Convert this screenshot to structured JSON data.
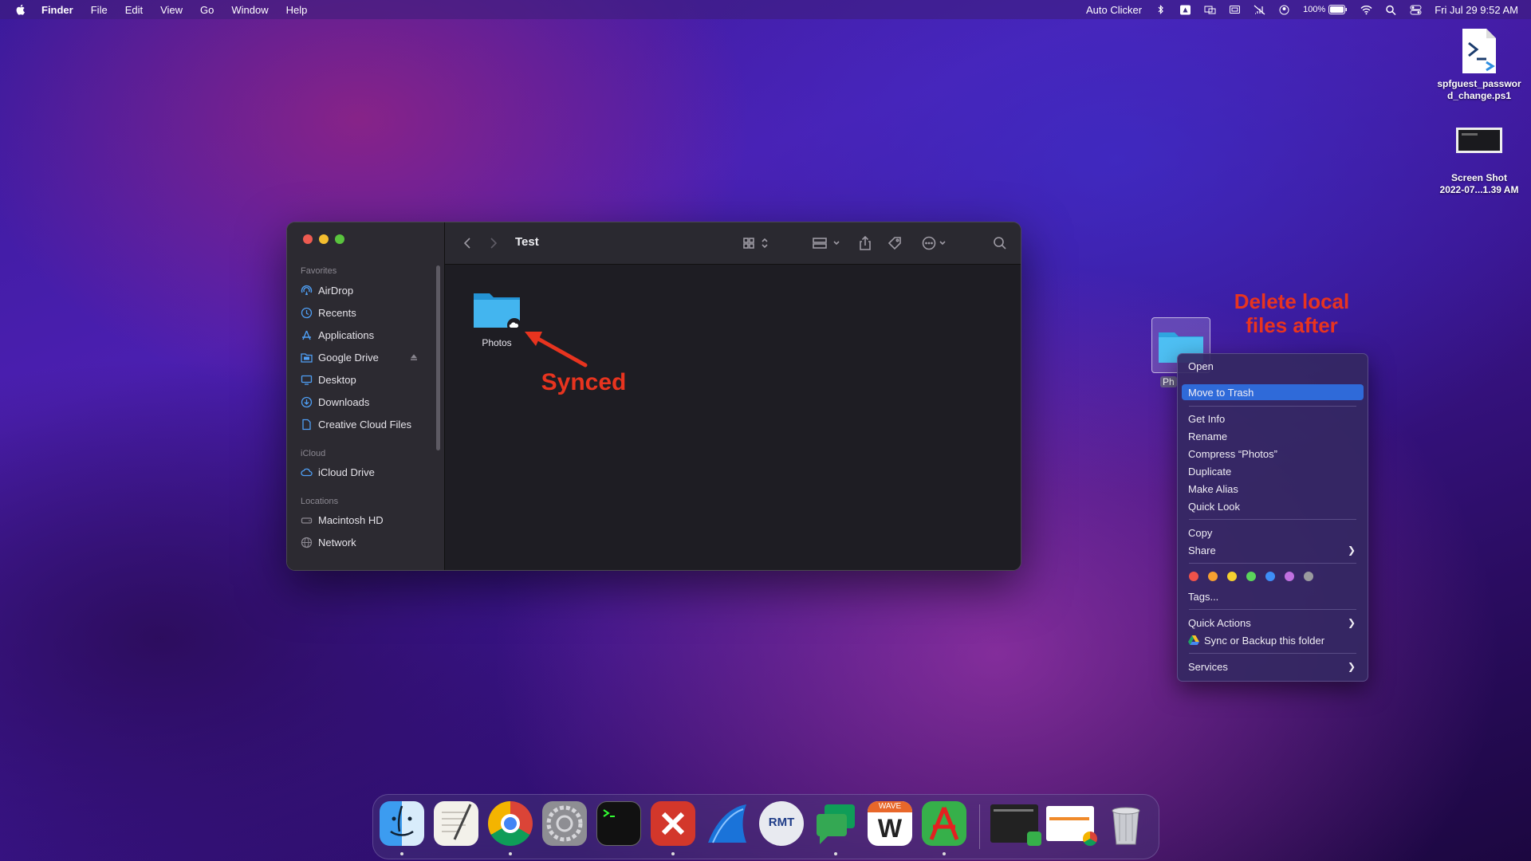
{
  "menubar": {
    "app_name": "Finder",
    "menus": [
      "File",
      "Edit",
      "View",
      "Go",
      "Window",
      "Help"
    ],
    "right": {
      "auto_clicker": "Auto Clicker",
      "battery": "100%",
      "datetime": "Fri Jul 29  9:52 AM"
    }
  },
  "desktop": {
    "items": [
      {
        "label_line1": "spfguest_passwor",
        "label_line2": "d_change.ps1",
        "icon": "powershell-script-icon"
      },
      {
        "label_line1": "Screen Shot",
        "label_line2": "2022-07...1.39 AM",
        "icon": "screenshot-file-icon"
      }
    ],
    "folder_partial_label": "Ph"
  },
  "finder": {
    "title": "Test",
    "sidebar": {
      "favorites_header": "Favorites",
      "favorites": [
        {
          "label": "AirDrop",
          "icon": "airdrop-icon"
        },
        {
          "label": "Recents",
          "icon": "clock-icon"
        },
        {
          "label": "Applications",
          "icon": "applications-icon"
        },
        {
          "label": "Google Drive",
          "icon": "folder-icon"
        },
        {
          "label": "Desktop",
          "icon": "desktop-icon"
        },
        {
          "label": "Downloads",
          "icon": "download-icon"
        },
        {
          "label": "Creative Cloud Files",
          "icon": "document-icon"
        }
      ],
      "icloud_header": "iCloud",
      "icloud": [
        {
          "label": "iCloud Drive",
          "icon": "cloud-icon"
        }
      ],
      "locations_header": "Locations",
      "locations": [
        {
          "label": "Macintosh HD",
          "icon": "disk-icon"
        },
        {
          "label": "Network",
          "icon": "globe-icon"
        }
      ]
    },
    "files": [
      {
        "label": "Photos",
        "icon": "folder-cloud-icon"
      }
    ]
  },
  "context_menu": {
    "items": {
      "open": "Open",
      "move_to_trash": "Move to Trash",
      "get_info": "Get Info",
      "rename": "Rename",
      "compress": "Compress “Photos”",
      "duplicate": "Duplicate",
      "make_alias": "Make Alias",
      "quick_look": "Quick Look",
      "copy": "Copy",
      "share": "Share",
      "tags": "Tags...",
      "quick_actions": "Quick Actions",
      "sync_backup": "Sync or Backup this folder",
      "services": "Services"
    },
    "tag_colors": [
      "#f0524a",
      "#f7a030",
      "#f6d02f",
      "#5bd45b",
      "#3e8ef7",
      "#c070e0",
      "#9a9a9e"
    ]
  },
  "annotations": {
    "synced": "Synced",
    "delete_line1": "Delete local",
    "delete_line2": "files after",
    "color": "#e8341f"
  },
  "dock": {
    "apps": [
      "finder-app",
      "textedit-app",
      "chrome-app",
      "system-preferences-app",
      "terminal-app",
      "remote-desktop-app",
      "wireshark-app",
      "rmt-app",
      "google-chat-app",
      "wave-app",
      "acrobat-app"
    ],
    "wave_label": "WAVE"
  }
}
